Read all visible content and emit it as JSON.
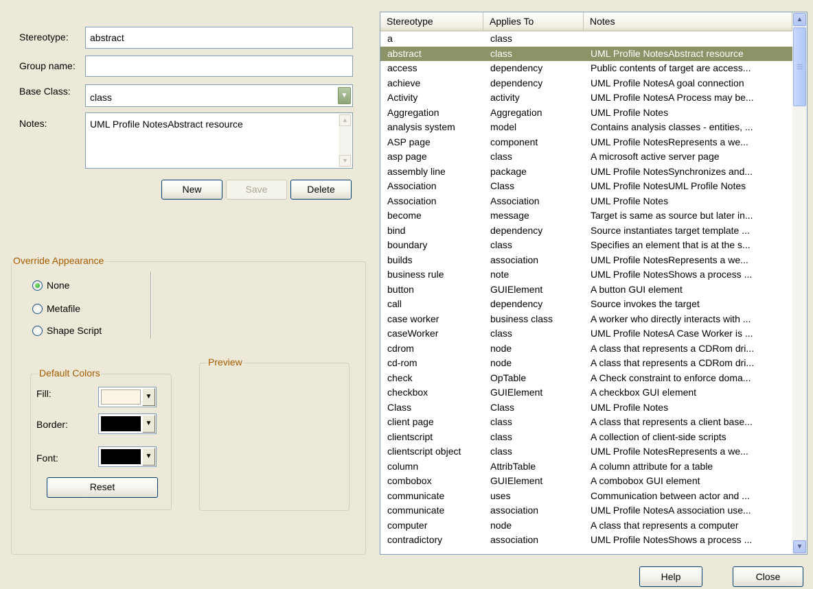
{
  "form": {
    "stereotype_label": "Stereotype:",
    "stereotype_value": "abstract",
    "group_label": "Group name:",
    "group_value": "",
    "base_label": "Base Class:",
    "base_value": "class",
    "notes_label": "Notes:",
    "notes_value": "UML Profile NotesAbstract resource",
    "new_label": "New",
    "save_label": "Save",
    "delete_label": "Delete"
  },
  "override": {
    "title": "Override Appearance",
    "options": [
      "None",
      "Metafile",
      "Shape Script"
    ],
    "selected": "None"
  },
  "colors": {
    "title": "Default Colors",
    "fill_label": "Fill:",
    "border_label": "Border:",
    "font_label": "Font:",
    "fill_color": "#fcf4e4",
    "border_color": "#000000",
    "font_color": "#000000",
    "reset_label": "Reset"
  },
  "preview": {
    "title": "Preview"
  },
  "list": {
    "headers": [
      "Stereotype",
      "Applies To",
      "Notes"
    ],
    "selected_index": 1,
    "selection_color": "#8a9467",
    "rows": [
      [
        "a",
        "class",
        ""
      ],
      [
        "abstract",
        "class",
        "UML Profile NotesAbstract resource"
      ],
      [
        "access",
        "dependency",
        "Public contents of target are access..."
      ],
      [
        "achieve",
        "dependency",
        "UML Profile NotesA goal connection"
      ],
      [
        "Activity",
        "activity",
        "UML Profile NotesA Process may be..."
      ],
      [
        "Aggregation",
        "Aggregation",
        "UML Profile Notes"
      ],
      [
        "analysis system",
        "model",
        "Contains analysis classes - entities, ..."
      ],
      [
        "ASP page",
        "component",
        "UML Profile NotesRepresents a we..."
      ],
      [
        "asp page",
        "class",
        "A microsoft active server page"
      ],
      [
        "assembly line",
        "package",
        "UML Profile NotesSynchronizes and..."
      ],
      [
        "Association",
        "Class",
        "UML Profile NotesUML Profile Notes"
      ],
      [
        "Association",
        "Association",
        "UML Profile Notes"
      ],
      [
        "become",
        "message",
        "Target is same as source but later in..."
      ],
      [
        "bind",
        "dependency",
        "Source instantiates target template ..."
      ],
      [
        "boundary",
        "class",
        "Specifies an element that is at the s..."
      ],
      [
        "builds",
        "association",
        "UML Profile NotesRepresents a we..."
      ],
      [
        "business rule",
        "note",
        "UML Profile NotesShows a process ..."
      ],
      [
        "button",
        "GUIElement",
        "A button GUI element"
      ],
      [
        "call",
        "dependency",
        "Source invokes the target"
      ],
      [
        "case worker",
        "business class",
        "A worker who directly interacts with ..."
      ],
      [
        "caseWorker",
        "class",
        "UML Profile NotesA Case Worker is ..."
      ],
      [
        "cdrom",
        "node",
        "A class that represents a CDRom dri..."
      ],
      [
        "cd-rom",
        "node",
        "A class that represents a CDRom dri..."
      ],
      [
        "check",
        "OpTable",
        "A Check constraint to enforce doma..."
      ],
      [
        "checkbox",
        "GUIElement",
        "A checkbox GUI element"
      ],
      [
        "Class",
        "Class",
        "UML Profile Notes"
      ],
      [
        "client page",
        "class",
        "A class that represents a client base..."
      ],
      [
        "clientscript",
        "class",
        "A collection of client-side scripts"
      ],
      [
        "clientscript object",
        "class",
        "UML Profile NotesRepresents a we..."
      ],
      [
        "column",
        "AttribTable",
        "A column attribute for a table"
      ],
      [
        "combobox",
        "GUIElement",
        "A combobox GUI element"
      ],
      [
        "communicate",
        "uses",
        "Communication between actor and ..."
      ],
      [
        "communicate",
        "association",
        "UML Profile NotesA association use..."
      ],
      [
        "computer",
        "node",
        "A class that represents a computer"
      ],
      [
        "contradictory",
        "association",
        "UML Profile NotesShows a process ..."
      ]
    ]
  },
  "footer": {
    "help_label": "Help",
    "close_label": "Close"
  },
  "icons": {
    "scroll_up": "▲",
    "scroll_down": "▼",
    "dropdown": "▼"
  }
}
